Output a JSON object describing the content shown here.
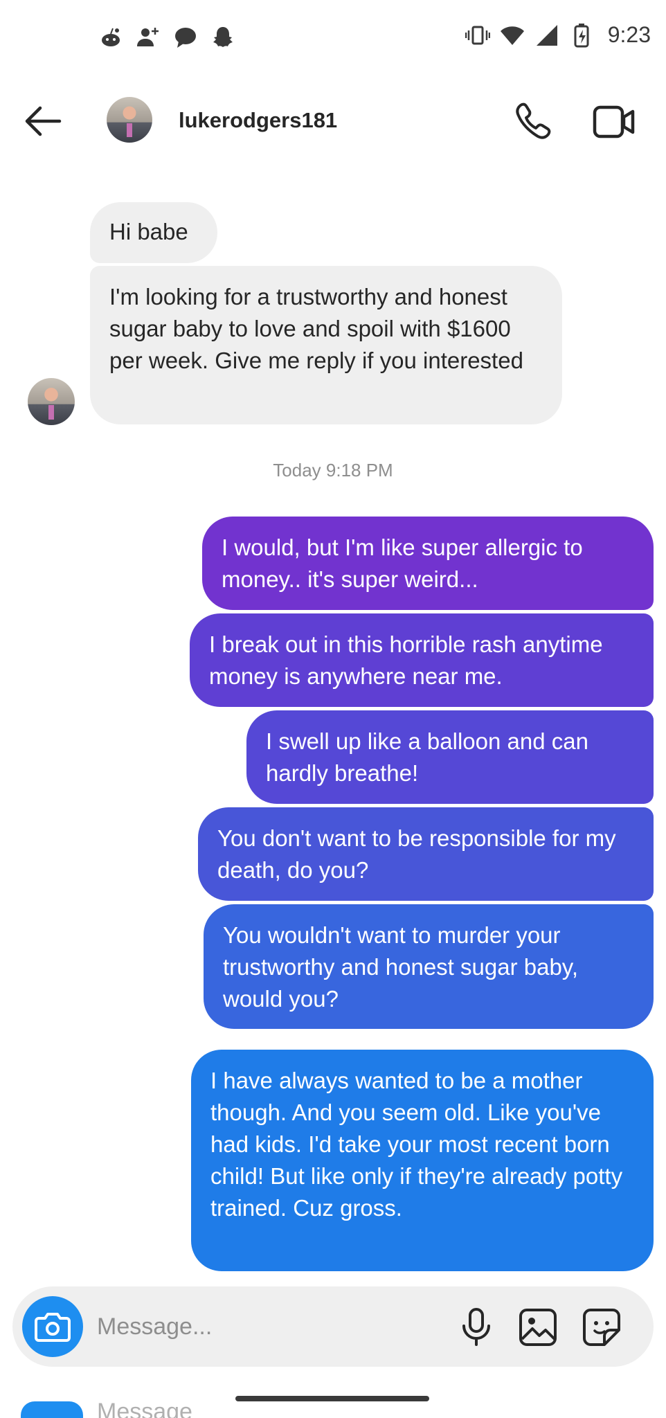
{
  "status_bar": {
    "time": "9:23",
    "left_icons": [
      "reddit-icon",
      "add-person-icon",
      "chat-bubble-icon",
      "snapchat-icon"
    ],
    "right_icons": [
      "vibrate-icon",
      "wifi-icon",
      "signal-icon",
      "battery-charging-icon"
    ]
  },
  "header": {
    "username": "lukerodgers181",
    "icons": [
      "back-arrow-icon",
      "phone-icon",
      "video-camera-icon"
    ]
  },
  "received_messages": [
    {
      "text": "Hi babe"
    },
    {
      "text": "I'm looking for a trustworthy and honest sugar baby to love and spoil with $1600 per week. Give me reply if you interested"
    }
  ],
  "timestamp": "Today 9:18 PM",
  "sent_messages": [
    {
      "text": "I would, but I'm like super allergic to money.. it's super weird..."
    },
    {
      "text": "I break out in this horrible rash anytime money is anywhere near me."
    },
    {
      "text": "I swell up like a balloon and can hardly breathe!"
    },
    {
      "text": "You don't want to be responsible for my death, do you?"
    },
    {
      "text": "You wouldn't want to murder your trustworthy and honest sugar baby, would you?"
    },
    {
      "text": "I have always wanted to be a mother though. And you seem old. Like you've had kids. I'd take your most recent born child! But like only if they're already potty trained. Cuz gross."
    }
  ],
  "colors": {
    "received_bubble": "#efefef",
    "sent_gradient_top": "#7233cf",
    "sent_gradient_bottom": "#1f7ce8",
    "camera_button": "#1e8ef0"
  },
  "composer": {
    "placeholder": "Message...",
    "icons": [
      "camera-icon",
      "microphone-icon",
      "gallery-icon",
      "sticker-icon"
    ]
  },
  "ghost_strip": {
    "text": "Message"
  }
}
